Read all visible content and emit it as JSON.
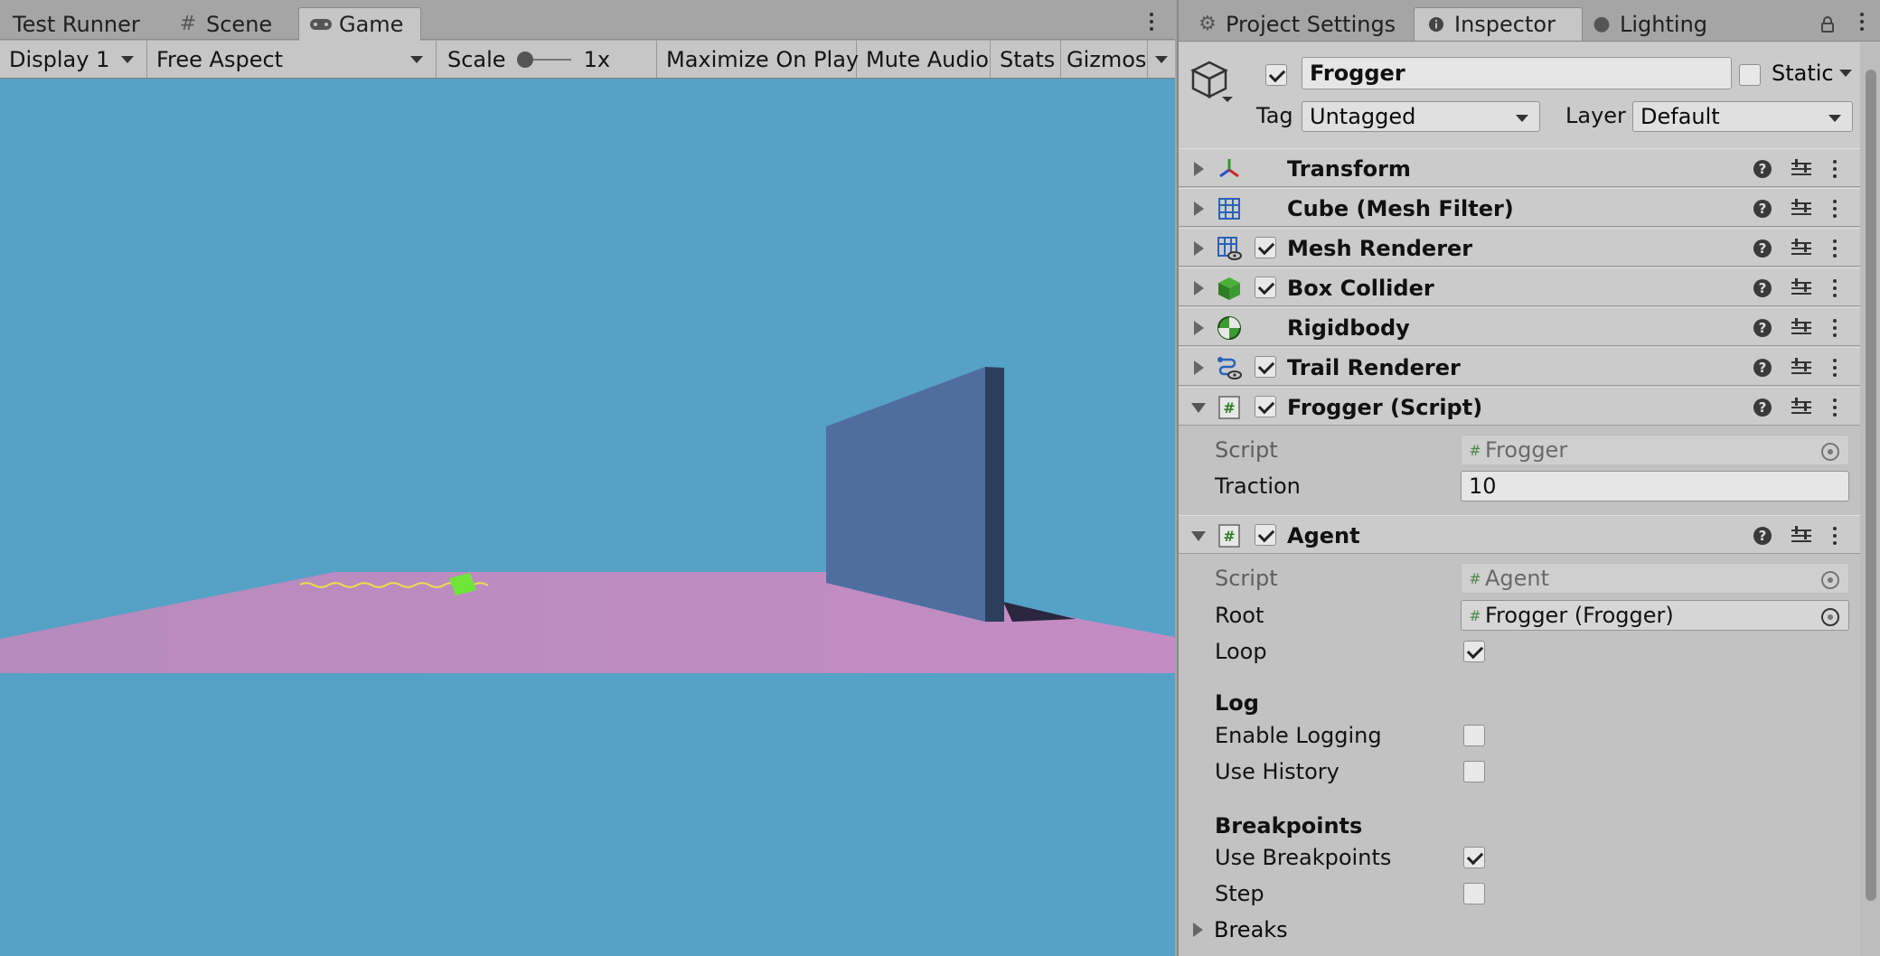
{
  "left_tabs": [
    {
      "label": "Test Runner",
      "icon": "none"
    },
    {
      "label": "Scene",
      "icon": "grid-icon"
    },
    {
      "label": "Game",
      "icon": "gamepad-icon",
      "active": true
    }
  ],
  "game_toolbar": {
    "display": "Display 1",
    "aspect": "Free Aspect",
    "scale_label": "Scale",
    "scale_value": "1x",
    "scale_level": 0.0,
    "maximize": "Maximize On Play",
    "mute": "Mute Audio",
    "stats": "Stats",
    "gizmos": "Gizmos"
  },
  "right_tabs": [
    {
      "label": "Project Settings",
      "icon": "gear-icon"
    },
    {
      "label": "Inspector",
      "icon": "info-icon",
      "active": true
    },
    {
      "label": "Lighting",
      "icon": "bulb-icon"
    }
  ],
  "object": {
    "name": "Frogger",
    "active": true,
    "static_label": "Static",
    "static": false,
    "tag_label": "Tag",
    "tag": "Untagged",
    "layer_label": "Layer",
    "layer": "Default"
  },
  "components": [
    {
      "name": "Transform",
      "icon": "transform-icon",
      "checkbox": null,
      "expanded": false
    },
    {
      "name": "Cube (Mesh Filter)",
      "icon": "mesh-filter-icon",
      "checkbox": null,
      "expanded": false
    },
    {
      "name": "Mesh Renderer",
      "icon": "mesh-renderer-icon",
      "checkbox": true,
      "expanded": false
    },
    {
      "name": "Box Collider",
      "icon": "box-collider-icon",
      "checkbox": true,
      "expanded": false
    },
    {
      "name": "Rigidbody",
      "icon": "rigidbody-icon",
      "checkbox": null,
      "expanded": false
    },
    {
      "name": "Trail Renderer",
      "icon": "trail-renderer-icon",
      "checkbox": true,
      "expanded": false
    },
    {
      "name": "Frogger (Script)",
      "icon": "script-icon",
      "checkbox": true,
      "expanded": true
    },
    {
      "name": "Agent",
      "icon": "script-icon",
      "checkbox": true,
      "expanded": true
    }
  ],
  "frogger_script": {
    "script_label": "Script",
    "script_value": "Frogger",
    "traction_label": "Traction",
    "traction_value": "10"
  },
  "agent": {
    "script_label": "Script",
    "script_value": "Agent",
    "root_label": "Root",
    "root_value": "Frogger (Frogger)",
    "loop_label": "Loop",
    "loop": true,
    "log_section": "Log",
    "enable_logging_label": "Enable Logging",
    "enable_logging": false,
    "use_history_label": "Use History",
    "use_history": false,
    "breakpoints_section": "Breakpoints",
    "use_breakpoints_label": "Use Breakpoints",
    "use_breakpoints": true,
    "step_label": "Step",
    "step": false,
    "breaks_label": "Breaks"
  },
  "colors": {
    "sky": "#56a1c6",
    "floor": "#bb8bbd",
    "wall_front": "#4f6e9f",
    "wall_side": "#2b3f5c",
    "frog": "#6fe53a",
    "trail": "#e8e04a"
  }
}
